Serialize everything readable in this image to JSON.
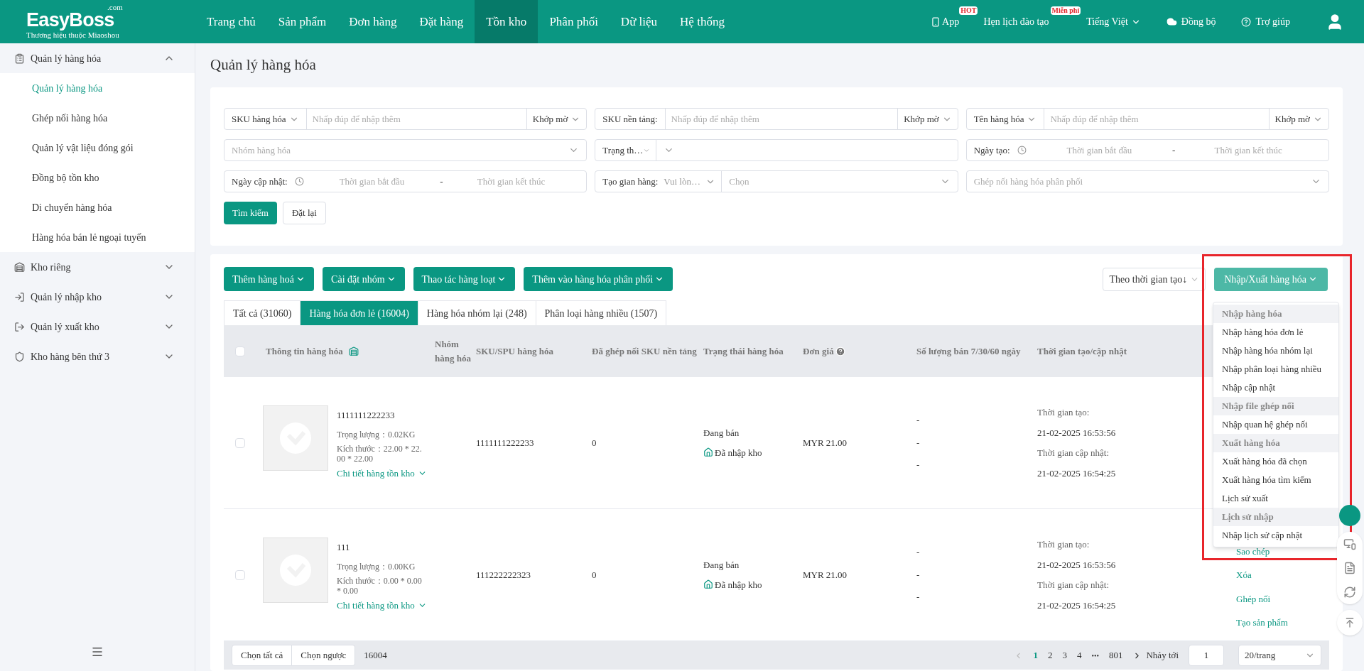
{
  "header": {
    "logo": {
      "brand": "EasyBoss",
      "suffix": ".com",
      "tagline": "Thương hiệu thuộc Miaoshou"
    },
    "nav": [
      {
        "label": "Trang chủ",
        "selected": false
      },
      {
        "label": "Sản phẩm",
        "selected": false
      },
      {
        "label": "Đơn hàng",
        "selected": false
      },
      {
        "label": "Đặt hàng",
        "selected": false
      },
      {
        "label": "Tồn kho",
        "selected": true
      },
      {
        "label": "Phân phối",
        "selected": false
      },
      {
        "label": "Dữ liệu",
        "selected": false
      },
      {
        "label": "Hệ thống",
        "selected": false
      }
    ],
    "app": {
      "label": "App",
      "badge": "HOT"
    },
    "training": {
      "label": "Hẹn lịch đào tạo",
      "badge": "Miễn phí"
    },
    "language": "Tiếng Việt",
    "sync": "Đồng bộ",
    "help": "Trợ giúp"
  },
  "sidebar": [
    {
      "label": "Quản lý hàng hóa",
      "expanded": true,
      "children": [
        {
          "label": "Quản lý hàng hóa",
          "selected": true
        },
        {
          "label": "Ghép nối hàng hóa",
          "selected": false
        },
        {
          "label": "Quản lý vật liệu đóng gói",
          "selected": false
        },
        {
          "label": "Đồng bộ tồn kho",
          "selected": false
        },
        {
          "label": "Di chuyển hàng hóa",
          "selected": false
        },
        {
          "label": "Hàng hóa bán lẻ ngoại tuyến",
          "selected": false
        }
      ]
    },
    {
      "label": "Kho riêng",
      "expanded": false
    },
    {
      "label": "Quản lý nhập kho",
      "expanded": false
    },
    {
      "label": "Quản lý xuất kho",
      "expanded": false
    },
    {
      "label": "Kho hàng bên thứ 3",
      "expanded": false
    }
  ],
  "page_title": "Quản lý hàng hóa",
  "filters": [
    {
      "kind": "search",
      "select": "SKU hàng hóa",
      "caret": true,
      "placeholder": "Nhấp đúp để nhập thêm",
      "match": "Khớp mờ"
    },
    {
      "kind": "search",
      "select": "SKU nền tảng:",
      "caret": false,
      "placeholder": "Nhấp đúp để nhập thêm",
      "match": "Khớp mờ"
    },
    {
      "kind": "search",
      "select": "Tên hàng hóa",
      "caret": true,
      "placeholder": "Nhấp đúp để nhập thêm",
      "match": "Khớp mờ"
    },
    {
      "kind": "select",
      "placeholder": "Nhóm hàng hóa"
    },
    {
      "kind": "split",
      "select": "Trạng th…"
    },
    {
      "kind": "date",
      "label": "Ngày tạo:",
      "start": "Thời gian bắt đầu",
      "separator": "-",
      "end": "Thời gian kết thúc"
    },
    {
      "kind": "date",
      "label": "Ngày cập nhật:",
      "start": "Thời gian bắt đầu",
      "separator": "-",
      "end": "Thời gian kết thúc"
    },
    {
      "kind": "split",
      "label": "Tạo gian hàng:",
      "select": "Vui lòn…",
      "placeholder": "Chọn"
    },
    {
      "kind": "select",
      "placeholder": "Ghép nối hàng hóa phân phối"
    }
  ],
  "search_button": "Tìm kiếm",
  "reset_button": "Đặt lại",
  "actions": [
    "Thêm hàng hoá",
    "Cài đặt nhóm",
    "Thao tác hàng loạt",
    "Thêm vào hàng hóa phân phối"
  ],
  "sort": "Theo thời gian tạo↓",
  "io_button": "Nhập/Xuất hàng hóa",
  "io_menu": [
    {
      "kind": "heading",
      "label": "Nhập hàng hóa"
    },
    {
      "kind": "item",
      "label": "Nhập hàng hóa đơn lẻ"
    },
    {
      "kind": "item",
      "label": "Nhập hàng hóa nhóm lại"
    },
    {
      "kind": "item",
      "label": "Nhập phân loại hàng nhiều"
    },
    {
      "kind": "item",
      "label": "Nhập cập nhật"
    },
    {
      "kind": "heading",
      "label": "Nhập file ghép nối"
    },
    {
      "kind": "item",
      "label": "Nhập quan hệ ghép nối"
    },
    {
      "kind": "heading",
      "label": "Xuất hàng hóa"
    },
    {
      "kind": "item",
      "label": "Xuất hàng hóa đã chọn"
    },
    {
      "kind": "item",
      "label": "Xuất hàng hóa tìm kiếm"
    },
    {
      "kind": "item",
      "label": "Lịch sử xuất"
    },
    {
      "kind": "heading",
      "label": "Lịch sử nhập"
    },
    {
      "kind": "item",
      "label": "Nhập lịch sử cập nhật"
    }
  ],
  "tabs": [
    {
      "label": "Tất cả (31060)",
      "selected": false
    },
    {
      "label": "Hàng hóa đơn lẻ (16004)",
      "selected": true
    },
    {
      "label": "Hàng hóa nhóm lại (248)",
      "selected": false
    },
    {
      "label": "Phân loại hàng nhiều (1507)",
      "selected": false
    }
  ],
  "table": {
    "select_all_checked": false,
    "columns": [
      "Thông tin hàng hóa",
      "Nhóm hàng hóa",
      "SKU/SPU hàng hóa",
      "Đã ghép nối SKU nền tảng",
      "Trạng thái hàng hóa",
      "Đơn giá",
      "Số lượng bán 7/30/60 ngày",
      "Thời gian tạo/cập nhật"
    ],
    "rows": [
      {
        "checked": false,
        "name": "1111111222233",
        "weight": "Trọng lượng：0.02KG",
        "size": "Kích thước：22.00 * 22.00 * 22.00",
        "stock_link": "Chi tiết hàng tồn kho",
        "sku": "1111111222233",
        "matched": "0",
        "status": "Đang bán",
        "stock_status": "Đã nhập kho",
        "price": "MYR 21.00",
        "sales": [
          "-",
          "-",
          "-"
        ],
        "created_label": "Thời gian tạo:",
        "created": "21-02-2025 16:53:56",
        "updated_label": "Thời gian cập nhật:",
        "updated": "21-02-2025 16:54:25",
        "actions": []
      },
      {
        "checked": false,
        "name": "111",
        "weight": "Trọng lượng：0.00KG",
        "size": "Kích thước：0.00 * 0.00 * 0.00",
        "stock_link": "Chi tiết hàng tồn kho",
        "sku": "111222222323",
        "matched": "0",
        "status": "Đang bán",
        "stock_status": "Đã nhập kho",
        "price": "MYR 21.00",
        "sales": [
          "-",
          "-",
          "-"
        ],
        "created_label": "Thời gian tạo:",
        "created": "21-02-2025 16:53:56",
        "updated_label": "Thời gian cập nhật:",
        "updated": "21-02-2025 16:54:25",
        "actions": [
          "Sao chép",
          "Xóa",
          "Ghép nối",
          "Tạo sản phẩm"
        ]
      }
    ]
  },
  "footer": {
    "select_all": "Chọn tất cả",
    "invert": "Chọn ngược",
    "count": "16004",
    "pages": [
      {
        "label": "1",
        "selected": true
      },
      {
        "label": "2",
        "selected": false
      },
      {
        "label": "3",
        "selected": false
      },
      {
        "label": "4",
        "selected": false
      }
    ],
    "ellipsis": "•••",
    "last": "801",
    "goto_label": "Nhảy tới",
    "goto_value": "1",
    "page_size": "20/trang"
  }
}
